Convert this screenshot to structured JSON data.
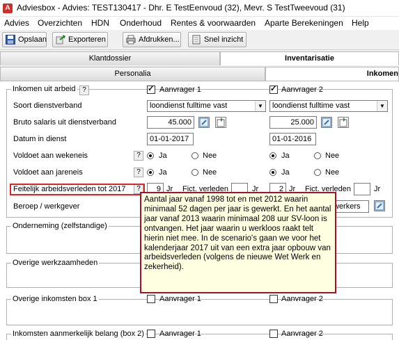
{
  "window": {
    "title": "Adviesbox - Advies: TEST130417 - Dhr. E TestEenvoud (32), Mevr. S TestTweevoud (31)",
    "icon_letter": "A"
  },
  "menu": [
    "Advies",
    "Overzichten",
    "HDN",
    "Onderhoud",
    "Rentes & voorwaarden",
    "Aparte Berekeningen",
    "Help"
  ],
  "toolbar": {
    "save": "Opslaan",
    "export": "Exporteren",
    "print": "Afdrukken...",
    "quick": "Snel inzicht"
  },
  "tabs_top": {
    "klantdossier": "Klantdossier",
    "inventarisatie": "Inventarisatie"
  },
  "tabs_sub": {
    "personalia": "Personalia",
    "inkomen": "Inkomen"
  },
  "form": {
    "inkomen_arbeid": "Inkomen uit arbeid",
    "help_q": "?",
    "aanvrager1": "Aanvrager 1",
    "aanvrager2": "Aanvrager 2",
    "soort_dienstverband": "Soort dienstverband",
    "dienstverband_a1": "loondienst fulltime vast",
    "dienstverband_a2": "loondienst fulltime vast",
    "bruto_salaris": "Bruto salaris uit dienstverband",
    "salaris_a1": "45.000",
    "salaris_a2": "25.000",
    "datum_in_dienst": "Datum in dienst",
    "datum_a1": "01-01-2017",
    "datum_a2": "01-01-2016",
    "wekeneis": "Voldoet aan wekeneis",
    "jareneis": "Voldoet aan jareneis",
    "ja": "Ja",
    "nee": "Nee",
    "feitelijk": "Feitelijk arbeidsverleden tot 2017",
    "jr_a1": "9",
    "jr_a2": "2",
    "jr": "Jr",
    "fict": "Fict. verleden",
    "beroep": "Beroep / werkgever",
    "beroep_a2_partial": "werkers",
    "onderneming": "Onderneming (zelfstandige)",
    "overige_werk": "Overige werkzaamheden",
    "overige_box1": "Overige inkomsten box 1",
    "aanmerkelijk": "Inkomsten aanmerkelijk belang (box 2)"
  },
  "tooltip": "Aantal jaar vanaf 1998 tot en met 2012 waarin minimaal 52 dagen per jaar is gewerkt. En het aantal jaar vanaf 2013 waarin minimaal 208 uur SV-loon is ontvangen. Het jaar waarin u werkloos raakt telt hierin niet mee. In de scenario's gaan we voor het kalenderjaar 2017 uit van een extra jaar opbouw van arbeidsverleden (volgens de nieuwe Wet Werk en zekerheid).",
  "colors": {
    "accent_red": "#d9262b",
    "tooltip_bg": "#ffffe1",
    "tooltip_border": "#a0142a"
  }
}
